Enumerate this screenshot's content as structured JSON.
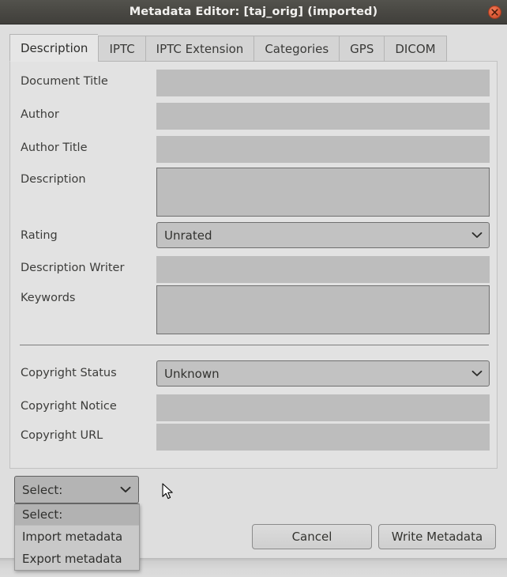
{
  "window": {
    "title": "Metadata Editor: [taj_orig] (imported)",
    "close_icon": "close-icon"
  },
  "tabs": [
    {
      "label": "Description",
      "active": true
    },
    {
      "label": "IPTC",
      "active": false
    },
    {
      "label": "IPTC Extension",
      "active": false
    },
    {
      "label": "Categories",
      "active": false
    },
    {
      "label": "GPS",
      "active": false
    },
    {
      "label": "DICOM",
      "active": false
    }
  ],
  "form": {
    "fields": [
      {
        "label": "Document Title",
        "type": "input",
        "value": ""
      },
      {
        "label": "Author",
        "type": "input",
        "value": ""
      },
      {
        "label": "Author Title",
        "type": "input",
        "value": ""
      },
      {
        "label": "Description",
        "type": "textarea",
        "value": ""
      },
      {
        "label": "Rating",
        "type": "combobox",
        "value": "Unrated"
      },
      {
        "label": "Description Writer",
        "type": "input",
        "value": ""
      },
      {
        "label": "Keywords",
        "type": "textarea",
        "value": ""
      },
      {
        "label": "Copyright Status",
        "type": "combobox",
        "value": "Unknown"
      },
      {
        "label": "Copyright Notice",
        "type": "input",
        "value": ""
      },
      {
        "label": "Copyright URL",
        "type": "input",
        "value": ""
      }
    ]
  },
  "select_menu": {
    "value": "Select:",
    "chevron_icon": "chevron-down-icon",
    "open": true,
    "options": [
      {
        "label": "Select:",
        "selected": true
      },
      {
        "label": "Import metadata",
        "selected": false
      },
      {
        "label": "Export metadata",
        "selected": false
      }
    ]
  },
  "actions": {
    "cancel_label": "Cancel",
    "write_label": "Write Metadata"
  },
  "colors": {
    "titlebar": "#4a4944",
    "panel": "#e2e2e2",
    "window": "#dedede",
    "field": "#bdbdbd",
    "close_button": "#e2613c",
    "highlight": "#b2b2b2"
  }
}
